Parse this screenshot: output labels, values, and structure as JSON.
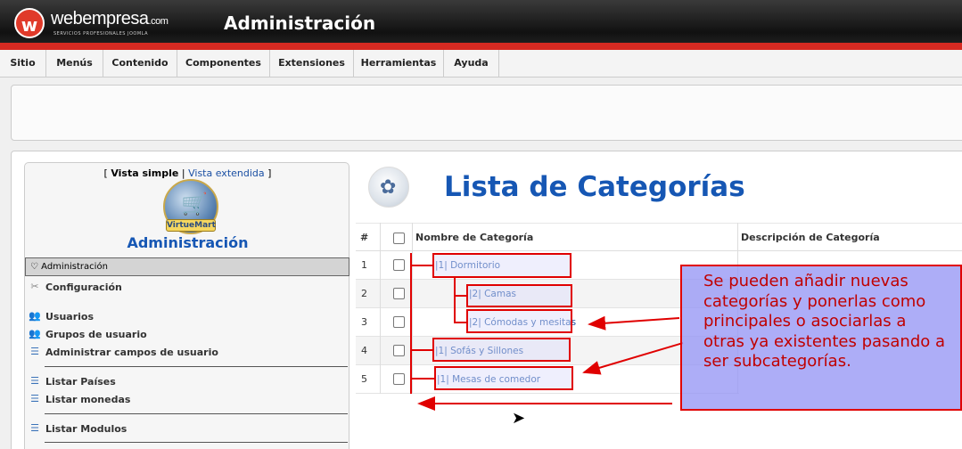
{
  "header": {
    "logo_letter": "w",
    "brand": "webempresa",
    "brand_suffix": ".com",
    "brand_tagline": "SERVICIOS PROFESIONALES JOOMLA",
    "title": "Administración"
  },
  "menu": [
    "Sitio",
    "Menús",
    "Contenido",
    "Componentes",
    "Extensiones",
    "Herramientas",
    "Ayuda"
  ],
  "sidebar": {
    "view_open": "[",
    "view_simple": "Vista simple",
    "view_sep": "|",
    "view_extended": "Vista extendida",
    "view_close": "]",
    "logo_badge": "VirtueMart",
    "title": "Administración",
    "active_item": "Administración",
    "items": [
      {
        "label": "Configuración",
        "icon": "tools-icon"
      },
      {
        "label": "Usuarios",
        "icon": "users-icon"
      },
      {
        "label": "Grupos de usuario",
        "icon": "users-icon"
      },
      {
        "label": "Administrar campos de usuario",
        "icon": "list-icon"
      },
      {
        "label": "Listar Países",
        "icon": "list-icon"
      },
      {
        "label": "Listar monedas",
        "icon": "list-icon"
      },
      {
        "label": "Listar Modulos",
        "icon": "list-icon"
      }
    ]
  },
  "main": {
    "title": "Lista de Categorías",
    "table": {
      "headers": [
        "#",
        "Nombre de Categoría",
        "Descripción de Categoría"
      ],
      "rows": [
        {
          "num": "1",
          "name": "|1| Dormitorio"
        },
        {
          "num": "2",
          "name": "|2| Camas"
        },
        {
          "num": "3",
          "name": "|2| Cómodas y mesitas"
        },
        {
          "num": "4",
          "name": "|1| Sofás y Sillones"
        },
        {
          "num": "5",
          "name": "|1| Mesas de comedor"
        }
      ]
    }
  },
  "annotation": {
    "text": "Se pueden añadir nuevas categorías y ponerlas como principales o asociarlas a otras ya existentes pasando a ser subcategorías.",
    "color": "#e00000"
  }
}
